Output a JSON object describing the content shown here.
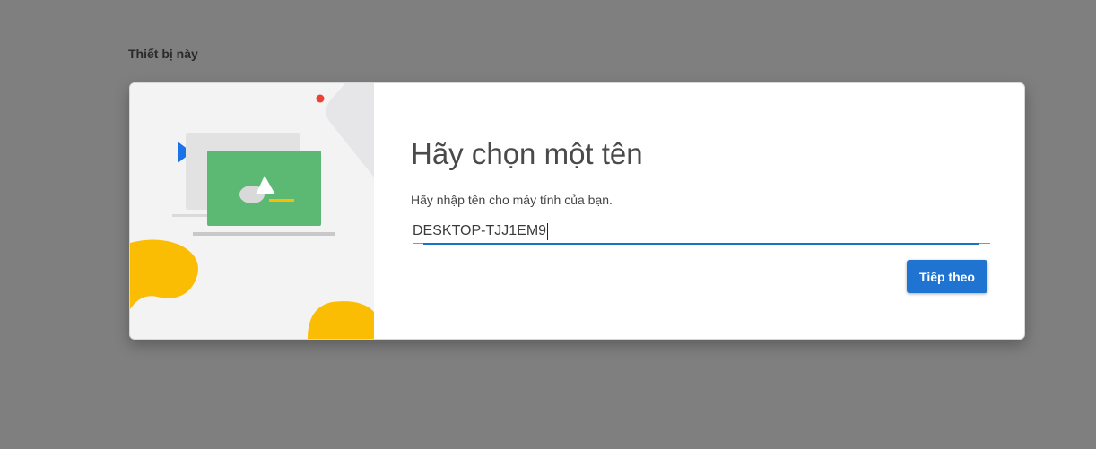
{
  "section": {
    "label": "Thiết bị này"
  },
  "dialog": {
    "title": "Hãy chọn một tên",
    "description": "Hãy nhập tên cho máy tính của bạn.",
    "name_input": {
      "value": "DESKTOP-TJJ1EM9"
    },
    "next_button_label": "Tiếp theo"
  },
  "colors": {
    "background": "#7f7f7f",
    "accent": "#1f73d1",
    "illustration_green": "#5bb974",
    "illustration_yellow": "#fbbc04",
    "illustration_blue": "#1a73e8",
    "illustration_red": "#ea4335"
  },
  "icons": {
    "illustration": "laptop-with-screen-illustration"
  }
}
